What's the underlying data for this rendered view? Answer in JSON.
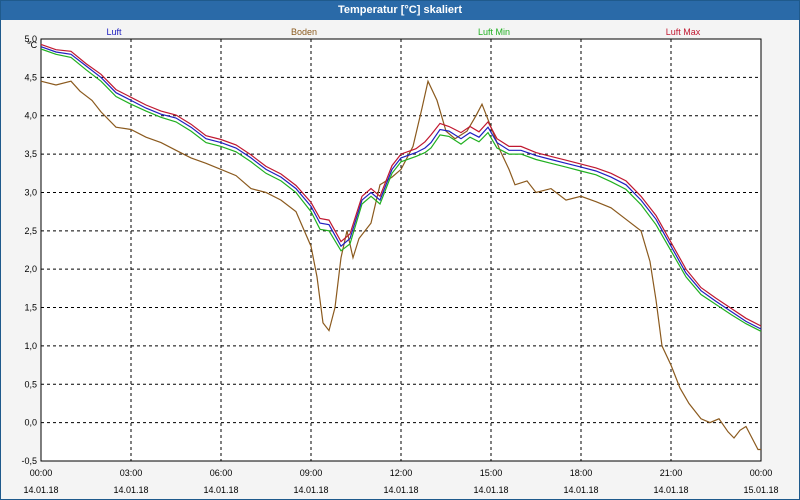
{
  "window": {
    "title": "Temperatur [°C] skaliert"
  },
  "chart_data": {
    "type": "line",
    "title": "Temperatur [°C] skaliert",
    "ylabel": "°C",
    "ylim": [
      -0.5,
      5.0
    ],
    "yticks": [
      "5,0",
      "4,5",
      "4,0",
      "3,5",
      "3,0",
      "2,5",
      "2,0",
      "1,5",
      "1,0",
      "0,5",
      "0,0",
      "-0,5"
    ],
    "xlim": [
      0,
      24
    ],
    "xticks": [
      {
        "time": "00:00",
        "date": "14.01.18"
      },
      {
        "time": "03:00",
        "date": "14.01.18"
      },
      {
        "time": "06:00",
        "date": "14.01.18"
      },
      {
        "time": "09:00",
        "date": "14.01.18"
      },
      {
        "time": "12:00",
        "date": "14.01.18"
      },
      {
        "time": "15:00",
        "date": "14.01.18"
      },
      {
        "time": "18:00",
        "date": "14.01.18"
      },
      {
        "time": "21:00",
        "date": "14.01.18"
      },
      {
        "time": "00:00",
        "date": "15.01.18"
      }
    ],
    "grid": true,
    "legend_position": "top",
    "series": [
      {
        "name": "Luft",
        "color": "#2020c0",
        "points": [
          [
            0,
            4.9
          ],
          [
            0.5,
            4.83
          ],
          [
            1,
            4.8
          ],
          [
            1.5,
            4.65
          ],
          [
            2,
            4.5
          ],
          [
            2.5,
            4.3
          ],
          [
            3,
            4.2
          ],
          [
            3.5,
            4.1
          ],
          [
            4,
            4.02
          ],
          [
            4.5,
            3.97
          ],
          [
            5,
            3.85
          ],
          [
            5.5,
            3.7
          ],
          [
            6,
            3.65
          ],
          [
            6.5,
            3.58
          ],
          [
            7,
            3.45
          ],
          [
            7.5,
            3.3
          ],
          [
            8,
            3.2
          ],
          [
            8.5,
            3.05
          ],
          [
            9,
            2.82
          ],
          [
            9.3,
            2.6
          ],
          [
            9.6,
            2.58
          ],
          [
            10,
            2.3
          ],
          [
            10.3,
            2.4
          ],
          [
            10.7,
            2.9
          ],
          [
            11,
            3.0
          ],
          [
            11.3,
            2.9
          ],
          [
            11.7,
            3.3
          ],
          [
            12,
            3.45
          ],
          [
            12.5,
            3.52
          ],
          [
            12.8,
            3.58
          ],
          [
            13,
            3.65
          ],
          [
            13.3,
            3.82
          ],
          [
            13.6,
            3.8
          ],
          [
            14,
            3.7
          ],
          [
            14.3,
            3.78
          ],
          [
            14.6,
            3.72
          ],
          [
            14.9,
            3.85
          ],
          [
            15.2,
            3.65
          ],
          [
            15.6,
            3.55
          ],
          [
            16,
            3.55
          ],
          [
            16.5,
            3.48
          ],
          [
            17,
            3.43
          ],
          [
            17.5,
            3.38
          ],
          [
            18,
            3.33
          ],
          [
            18.5,
            3.28
          ],
          [
            19,
            3.2
          ],
          [
            19.5,
            3.1
          ],
          [
            20,
            2.9
          ],
          [
            20.5,
            2.65
          ],
          [
            21,
            2.3
          ],
          [
            21.5,
            1.95
          ],
          [
            22,
            1.72
          ],
          [
            22.5,
            1.58
          ],
          [
            23,
            1.45
          ],
          [
            23.5,
            1.32
          ],
          [
            24,
            1.22
          ]
        ]
      },
      {
        "name": "Boden",
        "color": "#8b5a1e",
        "points": [
          [
            0,
            4.45
          ],
          [
            0.5,
            4.4
          ],
          [
            1,
            4.45
          ],
          [
            1.3,
            4.32
          ],
          [
            1.7,
            4.2
          ],
          [
            2,
            4.05
          ],
          [
            2.5,
            3.85
          ],
          [
            3,
            3.82
          ],
          [
            3.5,
            3.72
          ],
          [
            4,
            3.65
          ],
          [
            4.5,
            3.55
          ],
          [
            5,
            3.45
          ],
          [
            5.5,
            3.38
          ],
          [
            6,
            3.3
          ],
          [
            6.5,
            3.22
          ],
          [
            7,
            3.05
          ],
          [
            7.5,
            3.0
          ],
          [
            8,
            2.9
          ],
          [
            8.5,
            2.75
          ],
          [
            9,
            2.3
          ],
          [
            9.2,
            1.9
          ],
          [
            9.4,
            1.3
          ],
          [
            9.6,
            1.2
          ],
          [
            9.8,
            1.5
          ],
          [
            10,
            2.15
          ],
          [
            10.2,
            2.5
          ],
          [
            10.4,
            2.15
          ],
          [
            10.6,
            2.4
          ],
          [
            11,
            2.6
          ],
          [
            11.3,
            3.1
          ],
          [
            11.7,
            3.2
          ],
          [
            12,
            3.3
          ],
          [
            12.4,
            3.6
          ],
          [
            12.7,
            4.1
          ],
          [
            12.9,
            4.45
          ],
          [
            13.2,
            4.2
          ],
          [
            13.5,
            3.8
          ],
          [
            13.8,
            3.7
          ],
          [
            14.2,
            3.8
          ],
          [
            14.5,
            4.0
          ],
          [
            14.7,
            4.15
          ],
          [
            15,
            3.85
          ],
          [
            15.3,
            3.55
          ],
          [
            15.6,
            3.3
          ],
          [
            15.8,
            3.1
          ],
          [
            16.2,
            3.15
          ],
          [
            16.5,
            3.0
          ],
          [
            17,
            3.05
          ],
          [
            17.5,
            2.9
          ],
          [
            18,
            2.95
          ],
          [
            18.5,
            2.88
          ],
          [
            19,
            2.8
          ],
          [
            19.5,
            2.65
          ],
          [
            20,
            2.5
          ],
          [
            20.3,
            2.1
          ],
          [
            20.5,
            1.6
          ],
          [
            20.7,
            1.0
          ],
          [
            21,
            0.75
          ],
          [
            21.3,
            0.45
          ],
          [
            21.6,
            0.25
          ],
          [
            22,
            0.05
          ],
          [
            22.3,
            0.0
          ],
          [
            22.6,
            0.05
          ],
          [
            22.9,
            -0.12
          ],
          [
            23.1,
            -0.2
          ],
          [
            23.3,
            -0.1
          ],
          [
            23.5,
            -0.05
          ],
          [
            23.7,
            -0.2
          ],
          [
            23.9,
            -0.35
          ],
          [
            24,
            -0.35
          ]
        ]
      },
      {
        "name": "Luft Min",
        "color": "#20b020",
        "points": [
          [
            0,
            4.87
          ],
          [
            0.5,
            4.8
          ],
          [
            1,
            4.76
          ],
          [
            1.5,
            4.6
          ],
          [
            2,
            4.45
          ],
          [
            2.5,
            4.25
          ],
          [
            3,
            4.15
          ],
          [
            3.5,
            4.06
          ],
          [
            4,
            3.98
          ],
          [
            4.5,
            3.92
          ],
          [
            5,
            3.8
          ],
          [
            5.5,
            3.65
          ],
          [
            6,
            3.6
          ],
          [
            6.5,
            3.53
          ],
          [
            7,
            3.4
          ],
          [
            7.5,
            3.25
          ],
          [
            8,
            3.15
          ],
          [
            8.5,
            3.0
          ],
          [
            9,
            2.75
          ],
          [
            9.3,
            2.52
          ],
          [
            9.6,
            2.5
          ],
          [
            10,
            2.24
          ],
          [
            10.3,
            2.33
          ],
          [
            10.7,
            2.85
          ],
          [
            11,
            2.95
          ],
          [
            11.3,
            2.85
          ],
          [
            11.7,
            3.25
          ],
          [
            12,
            3.4
          ],
          [
            12.5,
            3.47
          ],
          [
            12.8,
            3.52
          ],
          [
            13,
            3.58
          ],
          [
            13.3,
            3.75
          ],
          [
            13.6,
            3.73
          ],
          [
            14,
            3.63
          ],
          [
            14.3,
            3.72
          ],
          [
            14.6,
            3.66
          ],
          [
            14.9,
            3.78
          ],
          [
            15.2,
            3.58
          ],
          [
            15.6,
            3.5
          ],
          [
            16,
            3.5
          ],
          [
            16.5,
            3.43
          ],
          [
            17,
            3.38
          ],
          [
            17.5,
            3.33
          ],
          [
            18,
            3.28
          ],
          [
            18.5,
            3.23
          ],
          [
            19,
            3.14
          ],
          [
            19.5,
            3.04
          ],
          [
            20,
            2.84
          ],
          [
            20.5,
            2.58
          ],
          [
            21,
            2.24
          ],
          [
            21.5,
            1.9
          ],
          [
            22,
            1.67
          ],
          [
            22.5,
            1.54
          ],
          [
            23,
            1.41
          ],
          [
            23.5,
            1.29
          ],
          [
            24,
            1.19
          ]
        ]
      },
      {
        "name": "Luft Max",
        "color": "#c01830",
        "points": [
          [
            0,
            4.93
          ],
          [
            0.5,
            4.86
          ],
          [
            1,
            4.84
          ],
          [
            1.5,
            4.68
          ],
          [
            2,
            4.54
          ],
          [
            2.5,
            4.34
          ],
          [
            3,
            4.24
          ],
          [
            3.5,
            4.14
          ],
          [
            4,
            4.06
          ],
          [
            4.5,
            4.01
          ],
          [
            5,
            3.89
          ],
          [
            5.5,
            3.74
          ],
          [
            6,
            3.69
          ],
          [
            6.5,
            3.62
          ],
          [
            7,
            3.49
          ],
          [
            7.5,
            3.34
          ],
          [
            8,
            3.24
          ],
          [
            8.5,
            3.09
          ],
          [
            9,
            2.87
          ],
          [
            9.3,
            2.66
          ],
          [
            9.6,
            2.64
          ],
          [
            10,
            2.36
          ],
          [
            10.3,
            2.46
          ],
          [
            10.7,
            2.95
          ],
          [
            11,
            3.05
          ],
          [
            11.3,
            2.95
          ],
          [
            11.7,
            3.35
          ],
          [
            12,
            3.5
          ],
          [
            12.5,
            3.57
          ],
          [
            12.8,
            3.66
          ],
          [
            13,
            3.75
          ],
          [
            13.3,
            3.9
          ],
          [
            13.6,
            3.86
          ],
          [
            14,
            3.78
          ],
          [
            14.3,
            3.86
          ],
          [
            14.6,
            3.79
          ],
          [
            14.9,
            3.92
          ],
          [
            15.2,
            3.7
          ],
          [
            15.6,
            3.6
          ],
          [
            16,
            3.6
          ],
          [
            16.5,
            3.52
          ],
          [
            17,
            3.47
          ],
          [
            17.5,
            3.42
          ],
          [
            18,
            3.37
          ],
          [
            18.5,
            3.32
          ],
          [
            19,
            3.25
          ],
          [
            19.5,
            3.15
          ],
          [
            20,
            2.95
          ],
          [
            20.5,
            2.7
          ],
          [
            21,
            2.35
          ],
          [
            21.5,
            2.0
          ],
          [
            22,
            1.76
          ],
          [
            22.5,
            1.62
          ],
          [
            23,
            1.49
          ],
          [
            23.5,
            1.36
          ],
          [
            24,
            1.26
          ]
        ]
      }
    ]
  }
}
